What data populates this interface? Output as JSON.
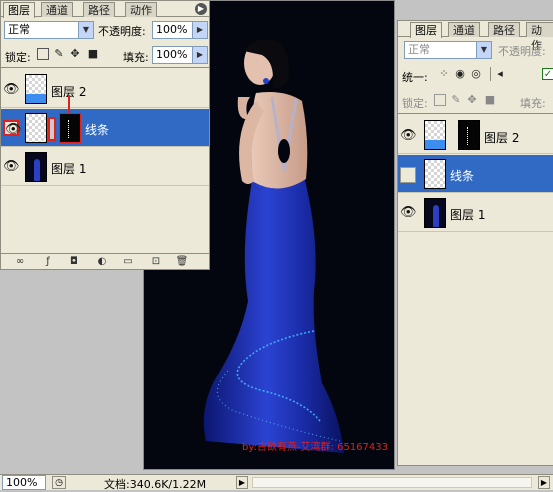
{
  "left_panel": {
    "tabs": [
      "图层",
      "通道",
      "路径",
      "动作"
    ],
    "blend_mode": "正常",
    "opacity_label": "不透明度:",
    "opacity_value": "100%",
    "lock_label": "锁定:",
    "fill_label": "填充:",
    "fill_value": "100%",
    "layers": [
      {
        "name": "图层 2",
        "visible": true,
        "selected": false
      },
      {
        "name": "线条",
        "visible": true,
        "selected": true
      },
      {
        "name": "图层 1",
        "visible": true,
        "selected": false
      }
    ]
  },
  "right_panel": {
    "tabs": [
      "图层",
      "通道",
      "路径",
      "动作"
    ],
    "blend_mode": "正常",
    "opacity_label": "不透明度:",
    "unify_label": "统一:",
    "lock_label": "锁定:",
    "fill_label": "填充:",
    "layers": [
      {
        "name": "图层 2",
        "visible": true,
        "selected": false
      },
      {
        "name": "线条",
        "visible": false,
        "selected": true
      },
      {
        "name": "图层 1",
        "visible": true,
        "selected": false
      }
    ]
  },
  "canvas": {
    "watermark": "by:古欲有燕-艾湾群: 65167433"
  },
  "status_bar": {
    "zoom": "100%",
    "doc_info": "文档:340.6K/1.22M"
  },
  "colors": {
    "selection_blue": "#316ac5",
    "panel_bg": "#ece9d8",
    "dress_blue": "#1b2fb0",
    "highlight_red": "#e0201a"
  }
}
